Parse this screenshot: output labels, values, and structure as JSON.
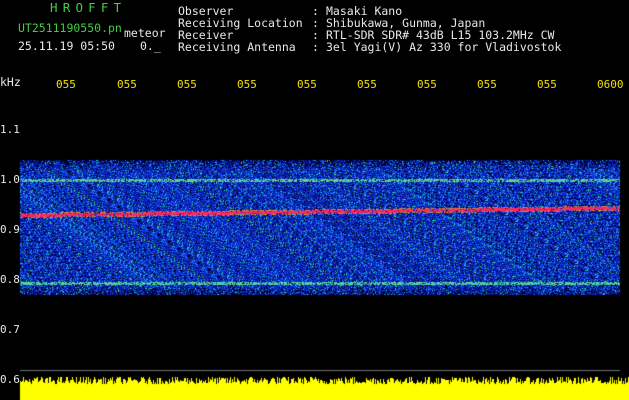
{
  "header": {
    "app_title": "HROFFT",
    "file_name": "UT2511190550.pn",
    "type_label": "meteor",
    "timestamp": "25.11.19 05:50",
    "count": "0._"
  },
  "info": [
    {
      "key": "Observer",
      "sep": ":",
      "value": "Masaki Kano"
    },
    {
      "key": "Receiving Location",
      "sep": ":",
      "value": "Shibukawa, Gunma, Japan"
    },
    {
      "key": "Receiver",
      "sep": ":",
      "value": "RTL-SDR SDR# 43dB L15 103.2MHz CW"
    },
    {
      "key": "Receiving Antenna",
      "sep": ":",
      "value": "3el Yagi(V) Az 330 for Vladivostok"
    }
  ],
  "axis": {
    "y_unit": "kHz",
    "y_ticks": [
      "1.1",
      "1.0",
      "0.9",
      "0.8",
      "0.7",
      "0.6"
    ],
    "x_ticks": [
      "055",
      "055",
      "055",
      "055",
      "055",
      "055",
      "055",
      "055",
      "055",
      "0600"
    ]
  },
  "colors": {
    "text_green": "#3ed03e",
    "text_white": "#e8e8e8",
    "text_yellow": "#f2e400",
    "background_noise": "#1f3cff",
    "signal_line": "#ff2060",
    "power_bar": "#ffff00"
  }
}
